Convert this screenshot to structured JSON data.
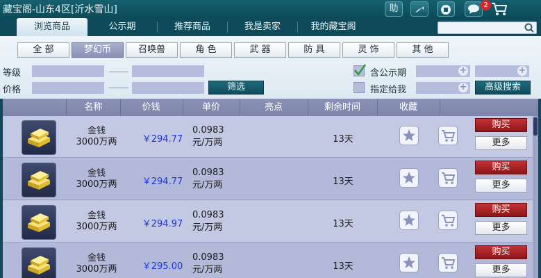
{
  "window": {
    "title": "藏宝阁-山东4区[沂水雪山]",
    "buttons": {
      "help": "助",
      "message_badge": "2"
    }
  },
  "tabs": [
    {
      "label": "浏览商品",
      "active": true
    },
    {
      "label": "公示期",
      "active": false
    },
    {
      "label": "推荐商品",
      "active": false
    },
    {
      "label": "我是卖家",
      "active": false
    },
    {
      "label": "我的藏宝阁",
      "active": false
    }
  ],
  "search": {
    "value": "",
    "placeholder": ""
  },
  "categories": [
    {
      "label": "全  部",
      "active": false
    },
    {
      "label": "梦幻币",
      "active": true
    },
    {
      "label": "召唤兽",
      "active": false
    },
    {
      "label": "角  色",
      "active": false
    },
    {
      "label": "武  器",
      "active": false
    },
    {
      "label": "防  具",
      "active": false
    },
    {
      "label": "灵  饰",
      "active": false
    },
    {
      "label": "其  他",
      "active": false
    }
  ],
  "filters": {
    "level_label": "等级",
    "price_label": "价格",
    "filter_button": "筛选",
    "public_period_label": "含公示期",
    "public_period_checked": true,
    "assign_label": "指定给我",
    "assign_checked": false,
    "advanced_button": "高级搜索"
  },
  "table": {
    "headers": [
      "名称",
      "价钱",
      "单价",
      "亮点",
      "剩余时间",
      "收藏"
    ],
    "rows": [
      {
        "name_line1": "金钱",
        "name_line2": "3000万两",
        "price": "￥294.77",
        "unit_line1": "0.0983",
        "unit_line2": "元/万两",
        "remaining": "13天",
        "buy": "购买",
        "more": "更多"
      },
      {
        "name_line1": "金钱",
        "name_line2": "3000万两",
        "price": "￥294.77",
        "unit_line1": "0.0983",
        "unit_line2": "元/万两",
        "remaining": "13天",
        "buy": "购买",
        "more": "更多"
      },
      {
        "name_line1": "金钱",
        "name_line2": "3000万两",
        "price": "￥294.97",
        "unit_line1": "0.0983",
        "unit_line2": "元/万两",
        "remaining": "13天",
        "buy": "购买",
        "more": "更多"
      },
      {
        "name_line1": "金钱",
        "name_line2": "3000万两",
        "price": "￥295.00",
        "unit_line1": "0.0983",
        "unit_line2": "元/万两",
        "remaining": "13天",
        "buy": "购买",
        "more": "更多"
      }
    ]
  },
  "colors": {
    "accent": "#0f4a5a",
    "price": "#1d34d8",
    "buy": "#b02a2e"
  }
}
